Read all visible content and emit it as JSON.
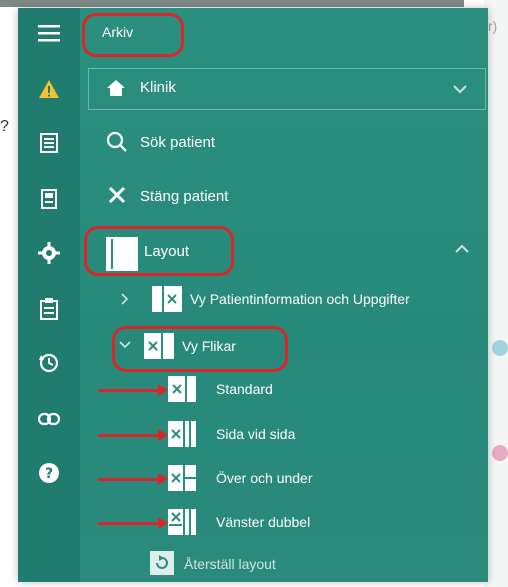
{
  "menu": {
    "title": "Arkiv",
    "clinic": "Klinik",
    "search_patient": "Sök patient",
    "close_patient": "Stäng patient",
    "layout": "Layout",
    "view_patient_info": "Vy Patientinformation och Uppgifter",
    "view_tabs": "Vy Flikar",
    "tab_options": [
      "Standard",
      "Sida vid sida",
      "Över och under",
      "Vänster dubbel"
    ],
    "reset_layout": "Återställ layout"
  },
  "background": {
    "fragment": "r)",
    "question_mark": "?"
  },
  "colors": {
    "panel": "#2b8f7f",
    "rail": "#1f7c6e",
    "annotation": "#d9262a",
    "warning": "#f2c230"
  }
}
